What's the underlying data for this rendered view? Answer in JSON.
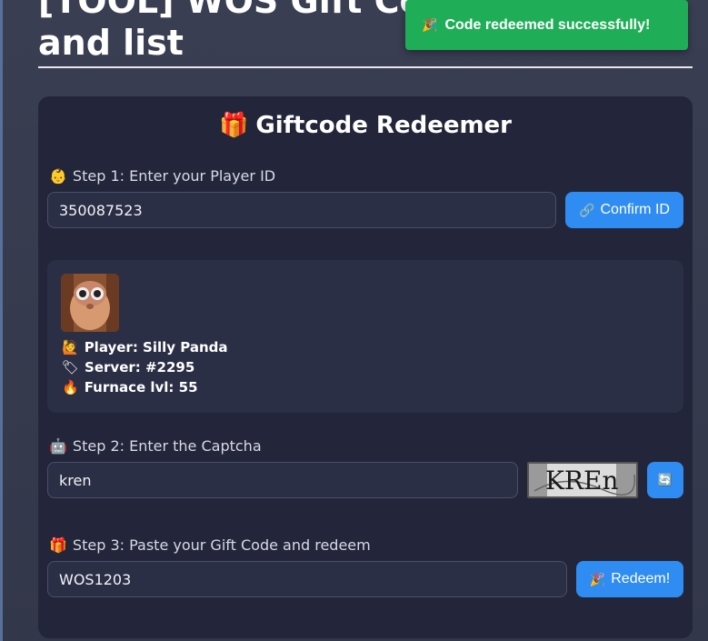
{
  "page": {
    "title": "[TOOL] WOS Gift Code\nand list"
  },
  "toast": {
    "icon": "party-popper-icon",
    "text": "Code redeemed successfully!",
    "color": "#1fae57"
  },
  "card": {
    "title": "Giftcode Redeemer",
    "title_icon": "gift-icon"
  },
  "step1": {
    "icon": "person-icon",
    "label": "Step 1: Enter your Player ID",
    "player_id_value": "350087523",
    "confirm_label": "Confirm ID",
    "confirm_icon": "link-icon"
  },
  "player": {
    "name_label": "Player: Silly Panda",
    "server_label": "Server: #2295",
    "furnace_label": "Furnace lvl: 55"
  },
  "step2": {
    "icon": "robot-icon",
    "label": "Step 2: Enter the Captcha",
    "captcha_value": "kren",
    "captcha_image_text": "KREn",
    "refresh_icon": "refresh-icon"
  },
  "step3": {
    "icon": "gift-icon",
    "label": "Step 3: Paste your Gift Code and redeem",
    "gift_code_value": "WOS1203",
    "redeem_label": "Redeem!",
    "redeem_icon": "party-popper-icon"
  },
  "colors": {
    "accent_button": "#2f8cf2",
    "card_background": "#23263a",
    "toast_success": "#1fae57"
  }
}
